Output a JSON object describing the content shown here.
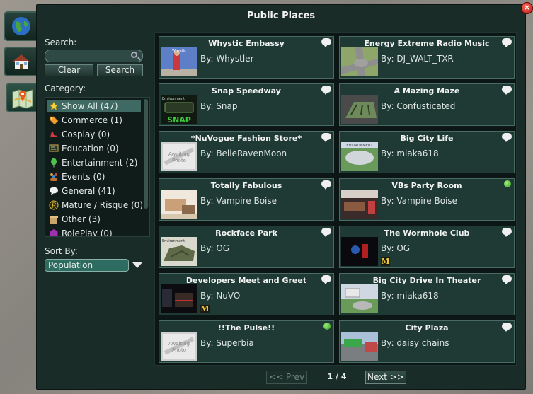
{
  "window": {
    "title": "Public Places",
    "close_glyph": "×"
  },
  "nav": [
    "globe-icon",
    "home-icon",
    "map-icon"
  ],
  "search": {
    "label": "Search:",
    "value": "",
    "clear_label": "Clear",
    "search_label": "Search"
  },
  "category": {
    "label": "Category:",
    "items": [
      {
        "label": "Show All (47)",
        "icon": "star-icon",
        "selected": true
      },
      {
        "label": "Commerce (1)",
        "icon": "tag-icon"
      },
      {
        "label": "Cosplay (0)",
        "icon": "shoe-icon"
      },
      {
        "label": "Education (0)",
        "icon": "chalkboard-icon"
      },
      {
        "label": "Entertainment (2)",
        "icon": "balloon-icon"
      },
      {
        "label": "Events (0)",
        "icon": "people-icon"
      },
      {
        "label": "General (41)",
        "icon": "speech-bubble-icon"
      },
      {
        "label": "Mature / Risque (0)",
        "icon": "r-badge-icon"
      },
      {
        "label": "Other (3)",
        "icon": "box-icon"
      },
      {
        "label": "RolePlay (0)",
        "icon": "mask-icon"
      }
    ]
  },
  "sort": {
    "label": "Sort By:",
    "value": "Population"
  },
  "places": [
    {
      "name": "Whystic Embassy",
      "by": "By: Whystler",
      "indicator": "bubble",
      "badge": "",
      "thumb": "whystic"
    },
    {
      "name": "Energy Extreme Radio Music",
      "by": "By: DJ_WALT_TXR",
      "indicator": "bubble",
      "badge": "",
      "thumb": "road"
    },
    {
      "name": "Snap Speedway",
      "by": "By: Snap",
      "indicator": "bubble",
      "badge": "",
      "thumb": "snap"
    },
    {
      "name": "A Mazing Maze",
      "by": "By: Confusticated",
      "indicator": "bubble",
      "badge": "",
      "thumb": "maze"
    },
    {
      "name": "*NuVogue Fashion Store*",
      "by": "By: BelleRavenMoon",
      "indicator": "bubble",
      "badge": "",
      "thumb": "awaiting"
    },
    {
      "name": "Big City Life",
      "by": "By: miaka618",
      "indicator": "bubble",
      "badge": "",
      "thumb": "bigcity"
    },
    {
      "name": "Totally Fabulous",
      "by": "By: Vampire Boise",
      "indicator": "bubble",
      "badge": "",
      "thumb": "fabulous"
    },
    {
      "name": "VBs Party Room",
      "by": "By: Vampire Boise",
      "indicator": "dot",
      "badge": "",
      "thumb": "party"
    },
    {
      "name": "Rockface Park",
      "by": "By: OG",
      "indicator": "bubble",
      "badge": "",
      "thumb": "rock"
    },
    {
      "name": "The Wormhole Club",
      "by": "By: OG",
      "indicator": "bubble",
      "badge": "M",
      "thumb": "wormhole"
    },
    {
      "name": "Developers Meet and Greet",
      "by": "By: NuVO",
      "indicator": "bubble",
      "badge": "M",
      "thumb": "dev"
    },
    {
      "name": "Big City Drive In Theater",
      "by": "By: miaka618",
      "indicator": "bubble",
      "badge": "",
      "thumb": "drivein"
    },
    {
      "name": "!!The Pulse!!",
      "by": "By: Superbia",
      "indicator": "dot",
      "badge": "",
      "thumb": "awaiting"
    },
    {
      "name": "City Plaza",
      "by": "By: daisy chains",
      "indicator": "bubble",
      "badge": "",
      "thumb": "plaza"
    }
  ],
  "thumb_text": {
    "awaiting": "Awaiting Photo",
    "env": "Environment",
    "snap": "SNAP",
    "whystic": "Whystic"
  },
  "pager": {
    "prev": "<< Prev",
    "info": "1 / 4",
    "next": "Next >>",
    "prev_enabled": false
  }
}
